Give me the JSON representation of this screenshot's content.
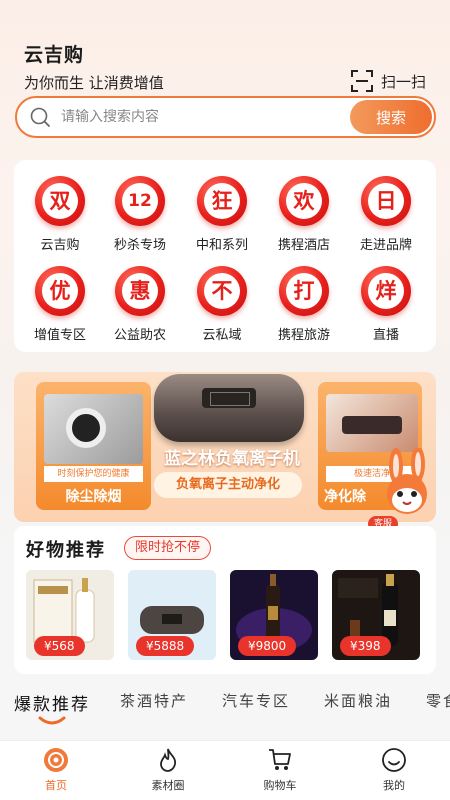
{
  "header": {
    "app_title": "云吉购",
    "slogan": "为你而生 让消费增值",
    "scan_label": "扫一扫"
  },
  "search": {
    "placeholder": "请输入搜索内容",
    "button_label": "搜索"
  },
  "shortcut_grid": [
    {
      "char": "双",
      "label": "云吉购"
    },
    {
      "char": "12",
      "label": "秒杀专场"
    },
    {
      "char": "狂",
      "label": "中和系列"
    },
    {
      "char": "欢",
      "label": "携程酒店"
    },
    {
      "char": "日",
      "label": "走进品牌"
    },
    {
      "char": "优",
      "label": "增值专区"
    },
    {
      "char": "惠",
      "label": "公益助农"
    },
    {
      "char": "不",
      "label": "云私域"
    },
    {
      "char": "打",
      "label": "携程旅游"
    },
    {
      "char": "烊",
      "label": "直播"
    }
  ],
  "banner": {
    "left_tag": "时刻保护您的健康",
    "left_label": "除尘除烟",
    "title": "蓝之林负氧离子机",
    "subtitle": "负氧离子主动净化",
    "right_tag": "极速洁净",
    "right_label": "净化除",
    "mascot_label": "客服"
  },
  "recommend": {
    "title": "好物推荐",
    "pill": "限时抢不停",
    "products": [
      {
        "price": "¥568"
      },
      {
        "price": "¥5888"
      },
      {
        "price": "¥9800"
      },
      {
        "price": "¥398"
      }
    ]
  },
  "category_tabs": [
    "爆款推荐",
    "茶酒特产",
    "汽车专区",
    "米面粮油",
    "零食"
  ],
  "bottom_nav": [
    {
      "label": "首页",
      "icon": "home-icon"
    },
    {
      "label": "素材圈",
      "icon": "flame-icon"
    },
    {
      "label": "购物车",
      "icon": "cart-icon"
    },
    {
      "label": "我的",
      "icon": "smile-icon"
    }
  ],
  "colors": {
    "accent": "#ef6d2e",
    "badge_red": "#e5211b",
    "price_red": "#e8342a"
  }
}
